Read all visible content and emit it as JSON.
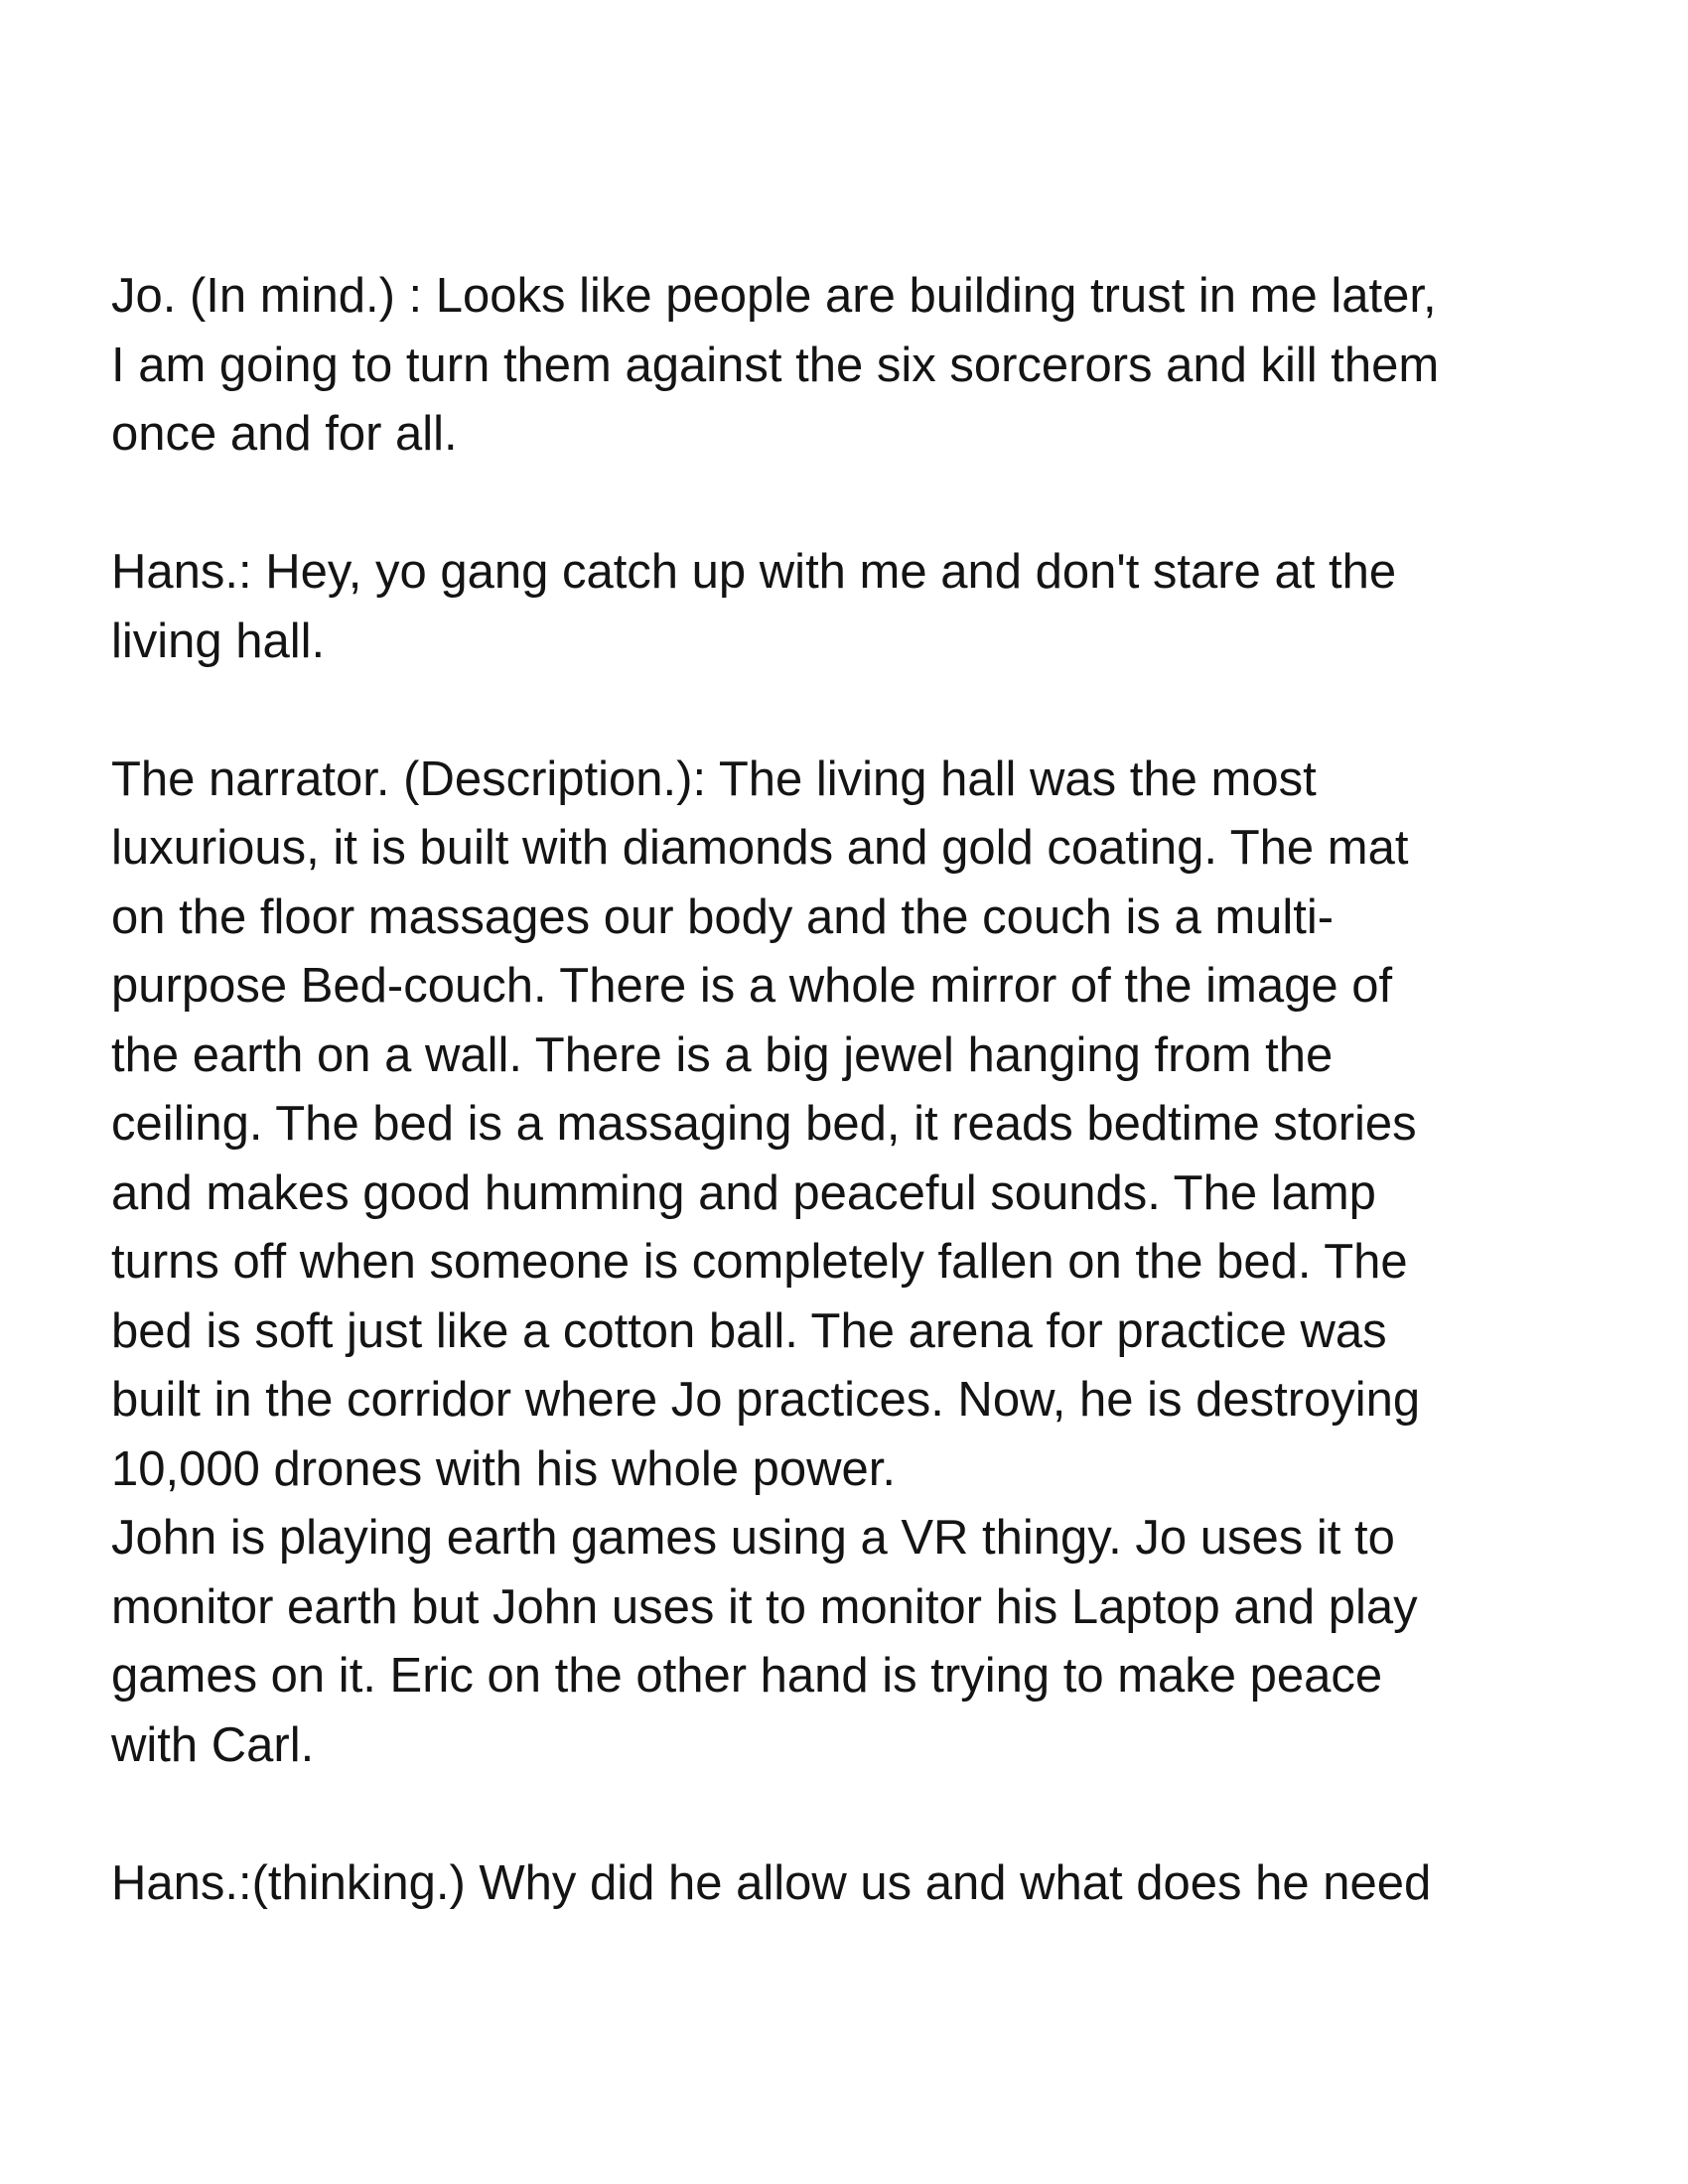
{
  "document": {
    "paragraphs": [
      "Jo. (In mind.) : Looks like people are building trust in me later,\nI am going to turn them against the six sorcerors and kill them\nonce and for all.",
      "Hans.: Hey, yo gang catch up with me and don't stare at the\nliving hall.",
      "The narrator. (Description.): The living hall was the most\nluxurious, it is built with diamonds and gold coating. The mat\non the floor massages our body and the couch is a multi-\npurpose Bed-couch. There is a whole mirror of the image of\nthe earth on a wall. There is a big jewel hanging from the\nceiling. The bed is a massaging bed, it reads bedtime stories\nand makes good humming and peaceful sounds. The lamp\nturns off when someone is completely fallen on the bed. The\nbed is soft just like a cotton ball. The arena for practice was\nbuilt in the corridor where Jo practices. Now, he is destroying\n10,000 drones with his whole power.",
      "John is playing earth games using a VR thingy. Jo uses it to\nmonitor earth but John uses it to monitor his Laptop and play\ngames on it. Eric on the other hand is trying to make peace\nwith Carl.",
      "Hans.:(thinking.) Why did he allow us and what does he need"
    ]
  }
}
